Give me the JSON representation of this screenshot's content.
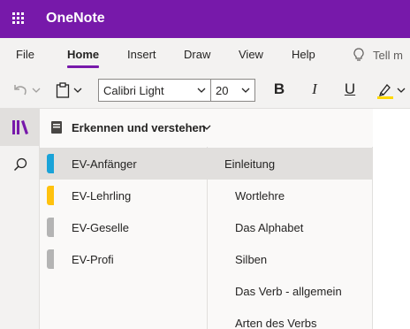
{
  "app": {
    "title": "OneNote"
  },
  "tabs": [
    {
      "label": "File",
      "active": false
    },
    {
      "label": "Home",
      "active": true
    },
    {
      "label": "Insert",
      "active": false
    },
    {
      "label": "Draw",
      "active": false
    },
    {
      "label": "View",
      "active": false
    },
    {
      "label": "Help",
      "active": false
    }
  ],
  "tellme": {
    "text": "Tell m"
  },
  "ribbon": {
    "font_name": "Calibri Light",
    "font_size": "20",
    "bold_label": "B",
    "italic_label": "I",
    "underline_label": "U",
    "highlight_color": "#ffd800"
  },
  "notebook": {
    "title": "Erkennen und verstehen"
  },
  "sections": [
    {
      "label": "EV-Anfänger",
      "color": "#1aa3d8",
      "selected": true
    },
    {
      "label": "EV-Lehrling",
      "color": "#ffc20e",
      "selected": false
    },
    {
      "label": "EV-Geselle",
      "color": "#b4b4b4",
      "selected": false
    },
    {
      "label": "EV-Profi",
      "color": "#b4b4b4",
      "selected": false
    }
  ],
  "pages": [
    {
      "label": "Einleitung",
      "selected": true,
      "level": 0
    },
    {
      "label": "Wortlehre",
      "selected": false,
      "level": 1
    },
    {
      "label": "Das Alphabet",
      "selected": false,
      "level": 1
    },
    {
      "label": "Silben",
      "selected": false,
      "level": 1
    },
    {
      "label": "Das Verb - allgemein",
      "selected": false,
      "level": 1
    },
    {
      "label": "Arten des Verbs",
      "selected": false,
      "level": 1
    }
  ],
  "colors": {
    "brand": "#7719aa",
    "accent_underline": "#7719aa"
  },
  "icons": [
    "waffle-icon",
    "lightbulb-icon",
    "undo-icon",
    "clipboard-icon",
    "highlighter-icon",
    "notebooks-icon",
    "search-icon",
    "notebook-icon"
  ]
}
